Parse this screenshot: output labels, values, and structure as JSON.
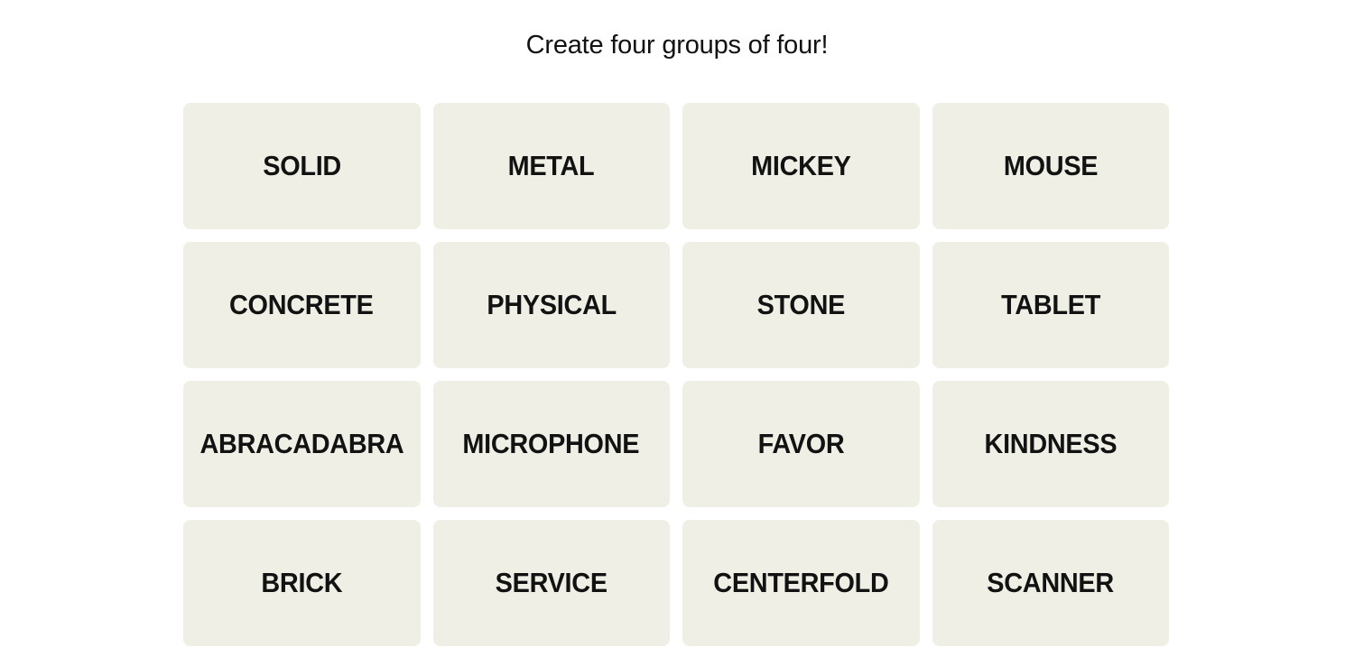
{
  "header": {
    "prompt": "Create four groups of four!"
  },
  "board": {
    "tiles": [
      "SOLID",
      "METAL",
      "MICKEY",
      "MOUSE",
      "CONCRETE",
      "PHYSICAL",
      "STONE",
      "TABLET",
      "ABRACADABRA",
      "MICROPHONE",
      "FAVOR",
      "KINDNESS",
      "BRICK",
      "SERVICE",
      "CENTERFOLD",
      "SCANNER"
    ]
  },
  "colors": {
    "tile_background": "#efefe6",
    "text": "#121212",
    "page_background": "#ffffff"
  }
}
